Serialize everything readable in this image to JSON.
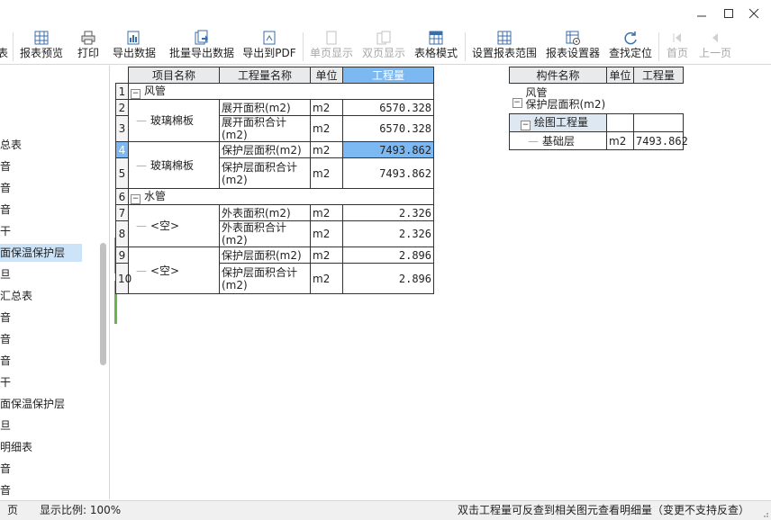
{
  "window": {
    "minimize_icon": "minimize-icon",
    "maximize_icon": "maximize-icon",
    "close_icon": "close-icon"
  },
  "toolbar": {
    "cut_label": "表",
    "preview_label": "报表预览",
    "print_label": "打印",
    "export_label": "导出数据",
    "batch_export_label": "批量导出数据",
    "export_pdf_label": "导出到PDF",
    "single_page_label": "单页显示",
    "double_page_label": "双页显示",
    "table_mode_label": "表格模式",
    "set_range_label": "设置报表范围",
    "report_settings_label": "报表设置器",
    "locate_label": "查找定位",
    "first_page_label": "首页",
    "prev_page_label": "上一页"
  },
  "sidebar": {
    "items": [
      "总表",
      "音",
      "音",
      "音",
      "干",
      "面保温保护层",
      "旦",
      "汇总表",
      "音",
      "音",
      "音",
      "干",
      "面保温保护层",
      "旦",
      "明细表",
      "音",
      "音"
    ]
  },
  "main_table": {
    "headers": [
      "项目名称",
      "工程量名称",
      "单位",
      "工程量"
    ],
    "group1": {
      "row": "1",
      "name": "风管"
    },
    "rows": [
      {
        "row": "2",
        "item": "玻璃棉板",
        "qty_name": "展开面积(m2)",
        "unit": "m2",
        "value": "6570.328"
      },
      {
        "row": "3",
        "item": "",
        "qty_name": "展开面积合计(m2)",
        "unit": "m2",
        "value": "6570.328"
      },
      {
        "row": "4",
        "item": "玻璃棉板",
        "qty_name": "保护层面积(m2)",
        "unit": "m2",
        "value": "7493.862"
      },
      {
        "row": "5",
        "item": "",
        "qty_name": "保护层面积合计(m2)",
        "unit": "m2",
        "value": "7493.862"
      }
    ],
    "group2": {
      "row": "6",
      "name": "水管"
    },
    "rows2": [
      {
        "row": "7",
        "item": "<空>",
        "qty_name": "外表面积(m2)",
        "unit": "m2",
        "value": "2.326"
      },
      {
        "row": "8",
        "item": "",
        "qty_name": "外表面积合计(m2)",
        "unit": "m2",
        "value": "2.326"
      },
      {
        "row": "9",
        "item": "<空>",
        "qty_name": "保护层面积(m2)",
        "unit": "m2",
        "value": "2.896"
      },
      {
        "row": "10",
        "item": "",
        "qty_name": "保护层面积合计(m2)",
        "unit": "m2",
        "value": "2.896"
      }
    ]
  },
  "detail_table": {
    "headers": [
      "构件名称",
      "单位",
      "工程量"
    ],
    "root_line1": "风管",
    "root_line2": "保护层面积(m2)",
    "group_label": "绘图工程量",
    "leaf": {
      "name": "基础层",
      "unit": "m2",
      "value": "7493.862"
    }
  },
  "status": {
    "page_label": "页",
    "zoom_label": "显示比例: 100%",
    "hint": "双击工程量可反查到相关图元查看明细量（变更不支持反查）"
  },
  "colors": {
    "accent": "#7cb8f2",
    "selection": "#cce3f8",
    "gutter": "#6ab44b"
  }
}
